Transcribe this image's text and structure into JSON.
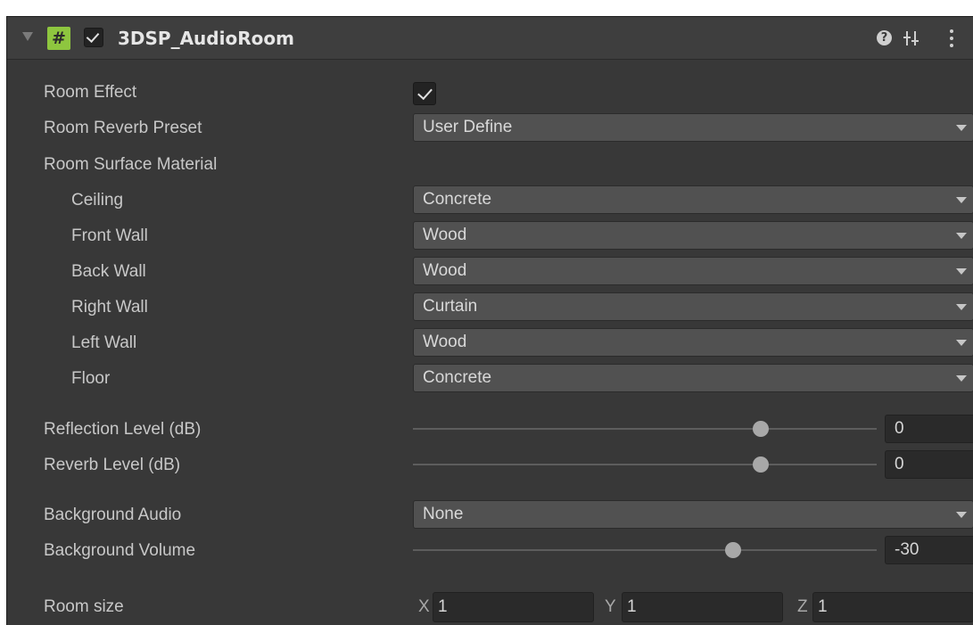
{
  "component": {
    "title": "3DSP_AudioRoom",
    "enabled": true,
    "icons": {
      "script": "script-hash-icon",
      "help": "help-icon",
      "presets": "presets-icon",
      "menu": "menu-icon"
    }
  },
  "labels": {
    "room_effect": "Room Effect",
    "room_reverb_preset": "Room Reverb Preset",
    "room_surface_material": "Room Surface Material",
    "ceiling": "Ceiling",
    "front_wall": "Front Wall",
    "back_wall": "Back Wall",
    "right_wall": "Right Wall",
    "left_wall": "Left Wall",
    "floor": "Floor",
    "reflection_level": "Reflection Level (dB)",
    "reverb_level": "Reverb Level (dB)",
    "background_audio": "Background Audio",
    "background_volume": "Background Volume",
    "room_size": "Room size"
  },
  "values": {
    "room_effect": true,
    "room_reverb_preset": "User Define",
    "ceiling": "Concrete",
    "front_wall": "Wood",
    "back_wall": "Wood",
    "right_wall": "Curtain",
    "left_wall": "Wood",
    "floor": "Concrete",
    "reflection_level": "0",
    "reverb_level": "0",
    "background_audio": "None",
    "background_volume": "-30"
  },
  "sliders": {
    "reflection_level_fraction": 0.75,
    "reverb_level_fraction": 0.75,
    "background_volume_fraction": 0.69
  },
  "room_size": {
    "x_label": "X",
    "x_value": "1",
    "y_label": "Y",
    "y_value": "1",
    "z_label": "Z",
    "z_value": "1"
  },
  "colors": {
    "panel_background": "#383838",
    "header_background": "#3e3e3e",
    "dropdown_background": "#515151",
    "field_background": "#2a2a2a",
    "script_icon_green": "#8ec63f",
    "label_text": "#c8c8c8"
  }
}
